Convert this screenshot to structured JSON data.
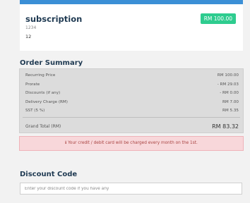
{
  "subscription": {
    "title": "subscription",
    "price_badge": "RM 100.00",
    "code": "1234",
    "quantity": "12",
    "accent_color": "#3b8fd6",
    "badge_color": "#2ecc8f"
  },
  "order_summary": {
    "heading": "Order Summary",
    "rows": [
      {
        "label": "Recurring Price",
        "value": "RM 100.00"
      },
      {
        "label": "Prorate",
        "value": "- RM 29.03"
      },
      {
        "label": "Discounts (if any)",
        "value": "- RM 0.00"
      },
      {
        "label": "Delivery Charge (RM)",
        "value": "RM 7.00"
      },
      {
        "label": "SST (5 %)",
        "value": "RM 5.35"
      }
    ],
    "grand_total": {
      "label": "Grand Total (RM)",
      "value": "RM 83.32"
    }
  },
  "alert": {
    "icon": "info-icon",
    "text": "ℹ Your credit / debit card will be charged every month on the 1st."
  },
  "discount": {
    "heading": "Discount Code",
    "placeholder": "Enter your discount code if you have any",
    "value": ""
  }
}
